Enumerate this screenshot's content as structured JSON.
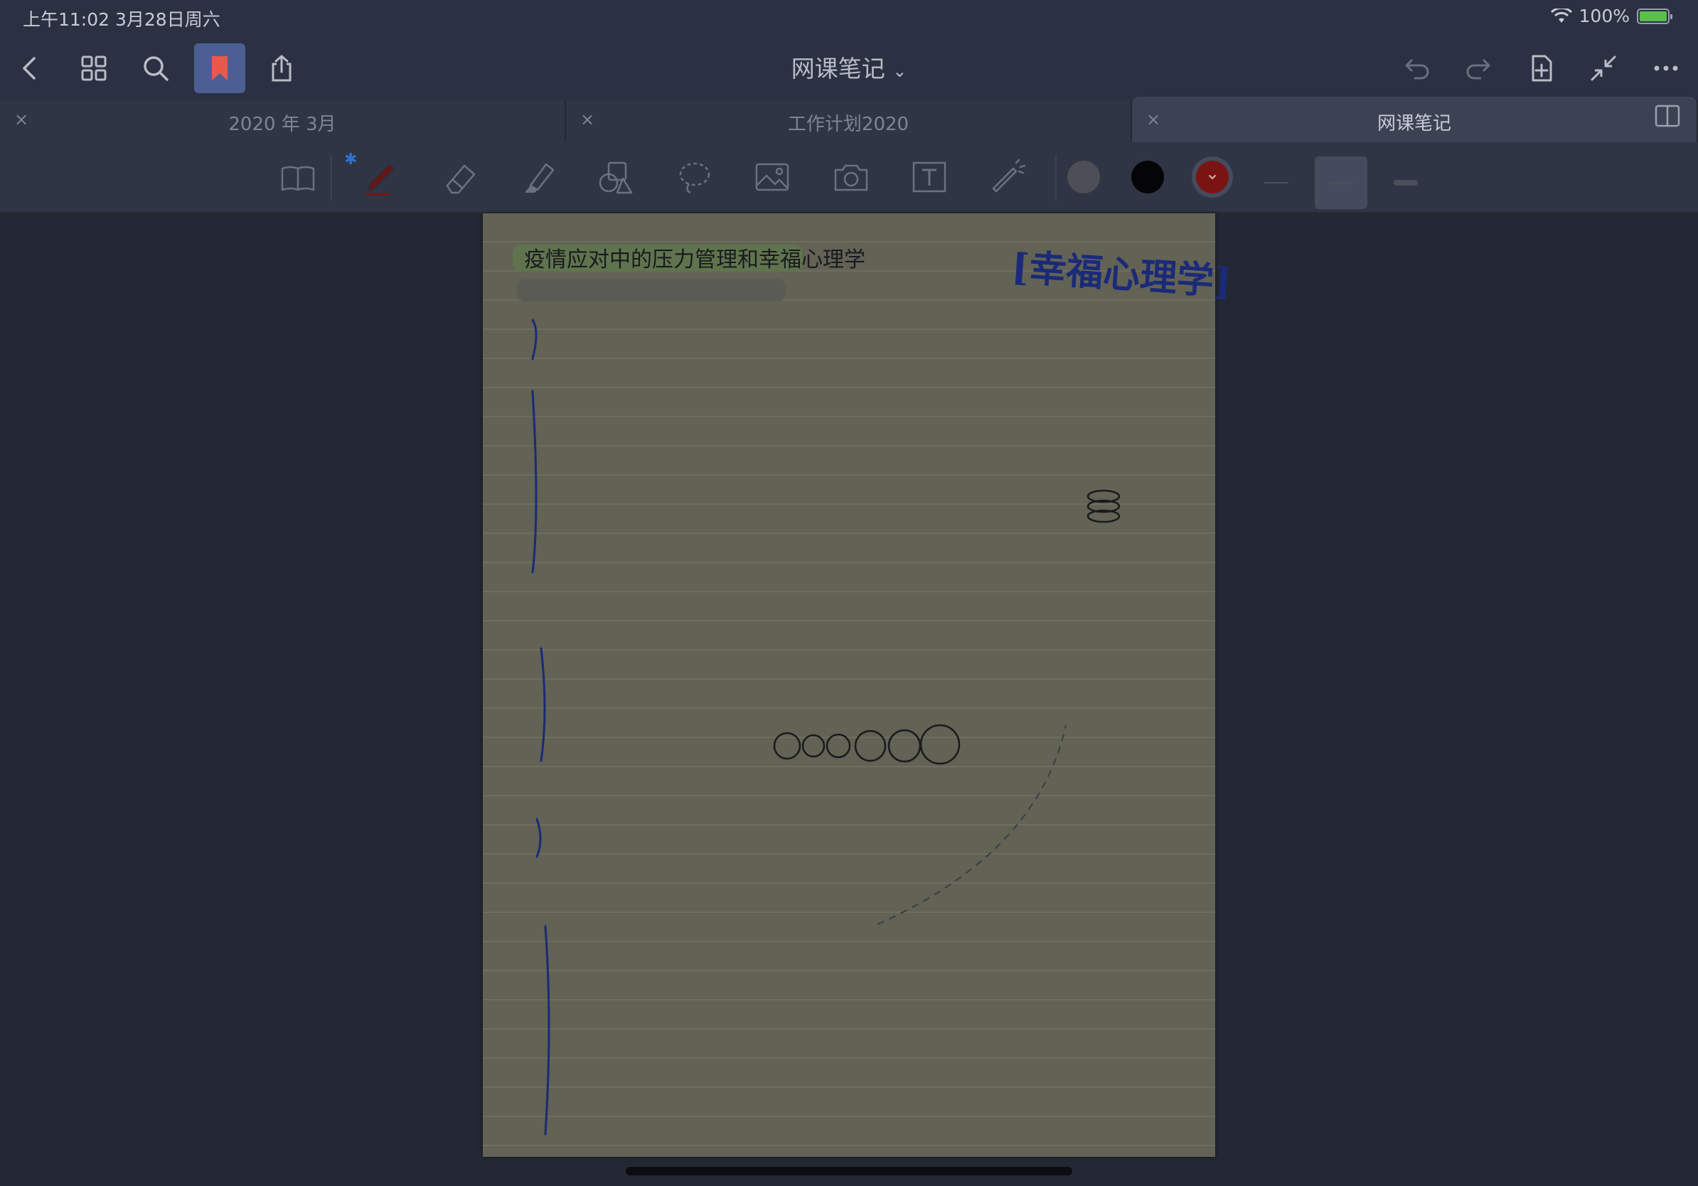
{
  "status_bar": {
    "time_date": "上午11:02   3月28日周六",
    "battery": "100%"
  },
  "navbar": {
    "title": "网课笔记",
    "title_chevron": "⌄"
  },
  "tabs": [
    {
      "label": "2020 年 3月",
      "close": "×"
    },
    {
      "label": "工作计划2020",
      "close": "×"
    },
    {
      "label": "网课笔记",
      "close": "×"
    }
  ],
  "toolbar": {
    "bluetooth": "✱",
    "colors": {
      "gray": "#4e4f56",
      "black": "#050507",
      "red": "#7a1412"
    }
  },
  "page": {
    "headline": "疫情应对中的压力管理和幸福心理学",
    "brand_title": "[幸福心理学]"
  }
}
